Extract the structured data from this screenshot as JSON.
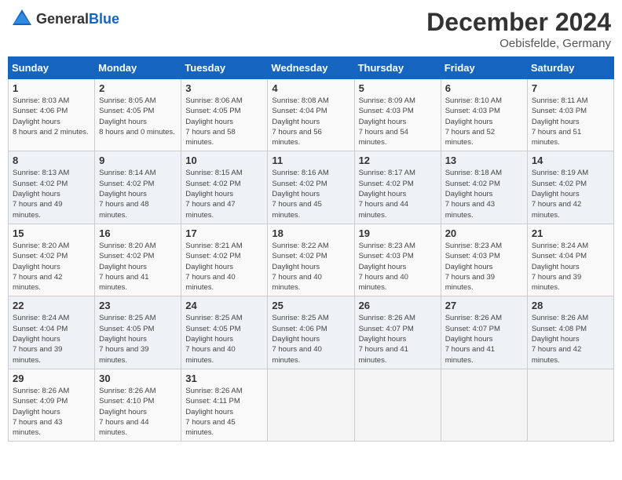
{
  "header": {
    "logo_general": "General",
    "logo_blue": "Blue",
    "month_year": "December 2024",
    "location": "Oebisfelde, Germany"
  },
  "weekdays": [
    "Sunday",
    "Monday",
    "Tuesday",
    "Wednesday",
    "Thursday",
    "Friday",
    "Saturday"
  ],
  "weeks": [
    [
      {
        "day": "1",
        "sunrise": "8:03 AM",
        "sunset": "4:06 PM",
        "daylight": "8 hours and 2 minutes."
      },
      {
        "day": "2",
        "sunrise": "8:05 AM",
        "sunset": "4:05 PM",
        "daylight": "8 hours and 0 minutes."
      },
      {
        "day": "3",
        "sunrise": "8:06 AM",
        "sunset": "4:05 PM",
        "daylight": "7 hours and 58 minutes."
      },
      {
        "day": "4",
        "sunrise": "8:08 AM",
        "sunset": "4:04 PM",
        "daylight": "7 hours and 56 minutes."
      },
      {
        "day": "5",
        "sunrise": "8:09 AM",
        "sunset": "4:03 PM",
        "daylight": "7 hours and 54 minutes."
      },
      {
        "day": "6",
        "sunrise": "8:10 AM",
        "sunset": "4:03 PM",
        "daylight": "7 hours and 52 minutes."
      },
      {
        "day": "7",
        "sunrise": "8:11 AM",
        "sunset": "4:03 PM",
        "daylight": "7 hours and 51 minutes."
      }
    ],
    [
      {
        "day": "8",
        "sunrise": "8:13 AM",
        "sunset": "4:02 PM",
        "daylight": "7 hours and 49 minutes."
      },
      {
        "day": "9",
        "sunrise": "8:14 AM",
        "sunset": "4:02 PM",
        "daylight": "7 hours and 48 minutes."
      },
      {
        "day": "10",
        "sunrise": "8:15 AM",
        "sunset": "4:02 PM",
        "daylight": "7 hours and 47 minutes."
      },
      {
        "day": "11",
        "sunrise": "8:16 AM",
        "sunset": "4:02 PM",
        "daylight": "7 hours and 45 minutes."
      },
      {
        "day": "12",
        "sunrise": "8:17 AM",
        "sunset": "4:02 PM",
        "daylight": "7 hours and 44 minutes."
      },
      {
        "day": "13",
        "sunrise": "8:18 AM",
        "sunset": "4:02 PM",
        "daylight": "7 hours and 43 minutes."
      },
      {
        "day": "14",
        "sunrise": "8:19 AM",
        "sunset": "4:02 PM",
        "daylight": "7 hours and 42 minutes."
      }
    ],
    [
      {
        "day": "15",
        "sunrise": "8:20 AM",
        "sunset": "4:02 PM",
        "daylight": "7 hours and 42 minutes."
      },
      {
        "day": "16",
        "sunrise": "8:20 AM",
        "sunset": "4:02 PM",
        "daylight": "7 hours and 41 minutes."
      },
      {
        "day": "17",
        "sunrise": "8:21 AM",
        "sunset": "4:02 PM",
        "daylight": "7 hours and 40 minutes."
      },
      {
        "day": "18",
        "sunrise": "8:22 AM",
        "sunset": "4:02 PM",
        "daylight": "7 hours and 40 minutes."
      },
      {
        "day": "19",
        "sunrise": "8:23 AM",
        "sunset": "4:03 PM",
        "daylight": "7 hours and 40 minutes."
      },
      {
        "day": "20",
        "sunrise": "8:23 AM",
        "sunset": "4:03 PM",
        "daylight": "7 hours and 39 minutes."
      },
      {
        "day": "21",
        "sunrise": "8:24 AM",
        "sunset": "4:04 PM",
        "daylight": "7 hours and 39 minutes."
      }
    ],
    [
      {
        "day": "22",
        "sunrise": "8:24 AM",
        "sunset": "4:04 PM",
        "daylight": "7 hours and 39 minutes."
      },
      {
        "day": "23",
        "sunrise": "8:25 AM",
        "sunset": "4:05 PM",
        "daylight": "7 hours and 39 minutes."
      },
      {
        "day": "24",
        "sunrise": "8:25 AM",
        "sunset": "4:05 PM",
        "daylight": "7 hours and 40 minutes."
      },
      {
        "day": "25",
        "sunrise": "8:25 AM",
        "sunset": "4:06 PM",
        "daylight": "7 hours and 40 minutes."
      },
      {
        "day": "26",
        "sunrise": "8:26 AM",
        "sunset": "4:07 PM",
        "daylight": "7 hours and 41 minutes."
      },
      {
        "day": "27",
        "sunrise": "8:26 AM",
        "sunset": "4:07 PM",
        "daylight": "7 hours and 41 minutes."
      },
      {
        "day": "28",
        "sunrise": "8:26 AM",
        "sunset": "4:08 PM",
        "daylight": "7 hours and 42 minutes."
      }
    ],
    [
      {
        "day": "29",
        "sunrise": "8:26 AM",
        "sunset": "4:09 PM",
        "daylight": "7 hours and 43 minutes."
      },
      {
        "day": "30",
        "sunrise": "8:26 AM",
        "sunset": "4:10 PM",
        "daylight": "7 hours and 44 minutes."
      },
      {
        "day": "31",
        "sunrise": "8:26 AM",
        "sunset": "4:11 PM",
        "daylight": "7 hours and 45 minutes."
      },
      null,
      null,
      null,
      null
    ]
  ],
  "labels": {
    "sunrise": "Sunrise:",
    "sunset": "Sunset:",
    "daylight": "Daylight hours"
  }
}
